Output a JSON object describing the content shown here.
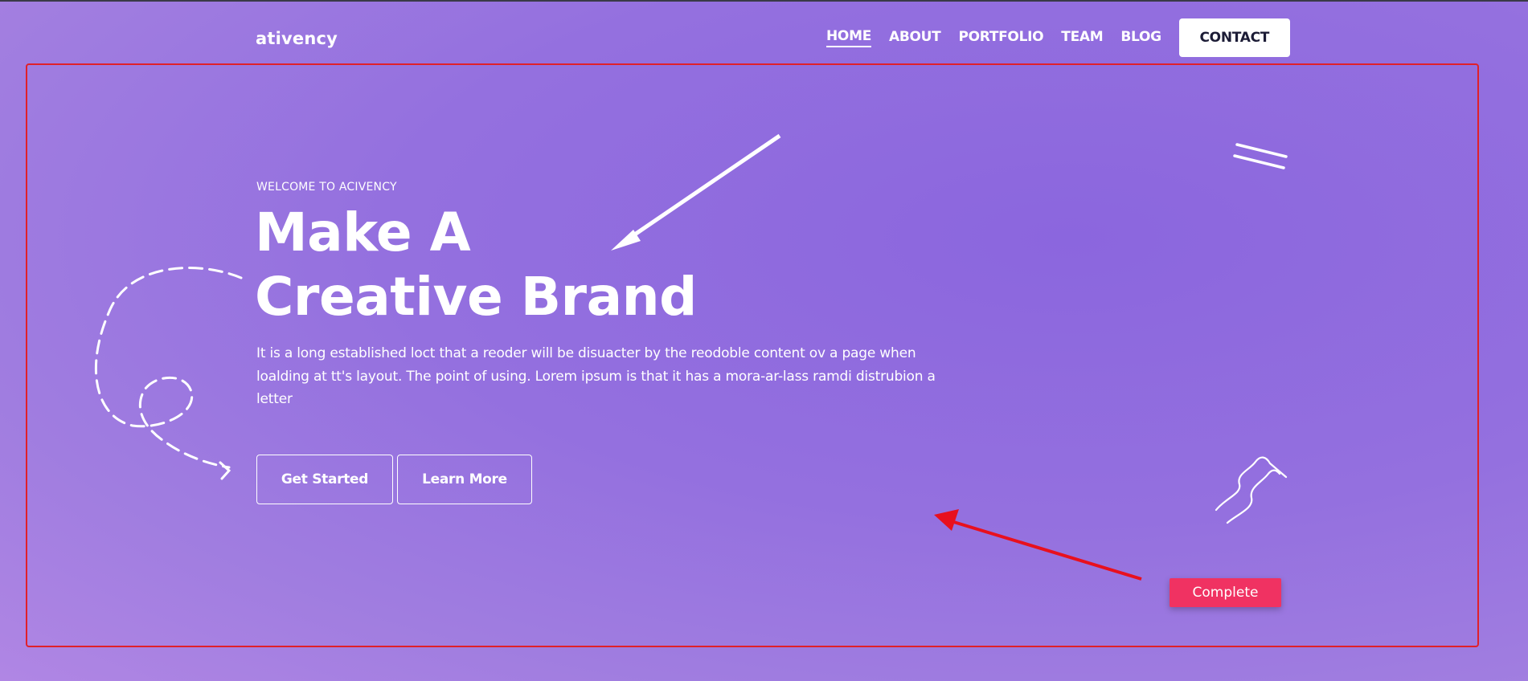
{
  "header": {
    "logo": "ativency",
    "nav": [
      "HOME",
      "ABOUT",
      "PORTFOLIO",
      "TEAM",
      "BLOG"
    ],
    "active_nav": "HOME",
    "contact_label": "CONTACT"
  },
  "hero": {
    "eyebrow": "WELCOME TO ACIVENCY",
    "title_line1": "Make A",
    "title_line2": "Creative Brand",
    "description": "It is a long established loct that a reoder will be disuacter by the reodoble content ov a page when loalding at tt's layout. The point of using. Lorem ipsum is that it has a mora-ar-lass ramdi distrubion a letter",
    "primary_button": "Get Started",
    "secondary_button": "Learn More"
  },
  "overlay": {
    "complete_label": "Complete"
  },
  "colors": {
    "background": "#9470df",
    "annotation_red": "#e0202a",
    "complete_pink": "#f03262",
    "text": "#ffffff"
  }
}
